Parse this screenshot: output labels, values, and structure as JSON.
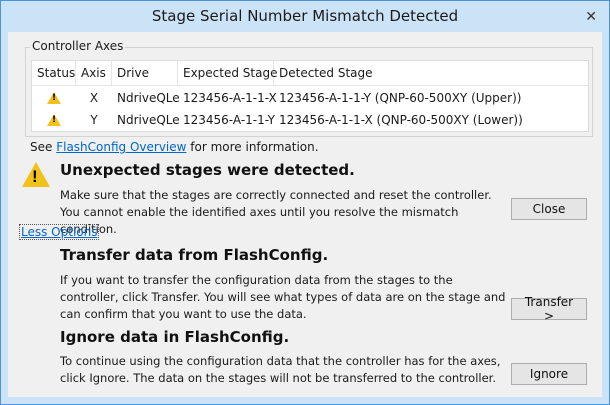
{
  "window": {
    "title": "Stage Serial Number Mismatch Detected",
    "close_glyph": "✕"
  },
  "controller_axes": {
    "label": "Controller Axes",
    "columns": [
      "Status",
      "Axis",
      "Drive",
      "Expected Stage",
      "Detected Stage"
    ],
    "rows": [
      {
        "status_icon": "warning-icon",
        "axis": "X",
        "drive": "NdriveQLe",
        "expected": "123456-A-1-1-X",
        "detected": "123456-A-1-1-Y (QNP-60-500XY (Upper))"
      },
      {
        "status_icon": "warning-icon",
        "axis": "Y",
        "drive": "NdriveQLe",
        "expected": "123456-A-1-1-Y",
        "detected": "123456-A-1-1-X (QNP-60-500XY (Lower))"
      }
    ]
  },
  "see_line": {
    "prefix": "See ",
    "link": "FlashConfig Overview",
    "suffix": " for more information."
  },
  "unexpected": {
    "heading": "Unexpected stages were detected.",
    "body": "Make sure that the stages are correctly connected and reset the controller.  You cannot enable the identified axes until you resolve the mismatch condition.",
    "button": "Close"
  },
  "less_options": "Less Options",
  "transfer": {
    "heading": "Transfer data from FlashConfig.",
    "body": "If you want to transfer the configuration data from the stages to the controller, click Transfer.  You will see what types of data are on the stage and can confirm that you want to use the data.",
    "button": "Transfer >"
  },
  "ignore": {
    "heading": "Ignore data in FlashConfig.",
    "body": "To continue using the configuration data that the controller has for the axes, click Ignore.  The data on the stages will not be transferred to the controller.",
    "button": "Ignore"
  },
  "colors": {
    "title_bar": "#cbe3f7",
    "link": "#0066cc",
    "warning": "#f2c21b"
  }
}
